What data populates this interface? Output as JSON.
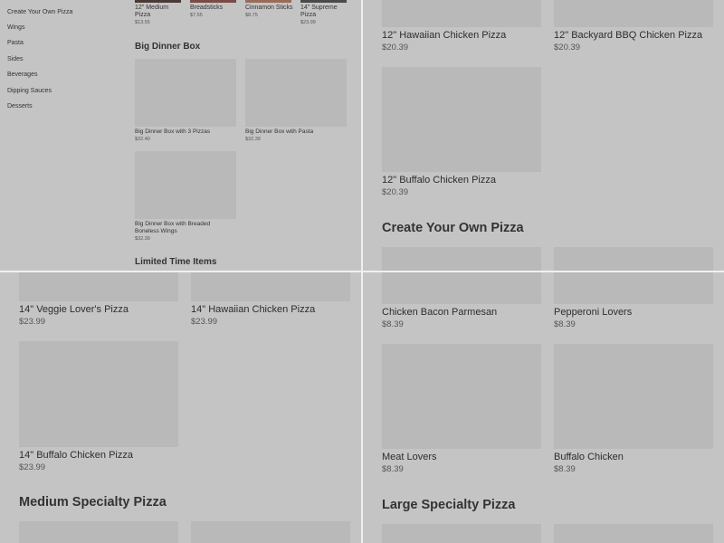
{
  "sidebar": {
    "items": [
      "Create Your Own Pizza",
      "Wings",
      "Pasta",
      "Sides",
      "Beverages",
      "Dipping Sauces",
      "Desserts"
    ]
  },
  "q1": {
    "top_items": [
      {
        "name": "12\" Medium Pizza",
        "price": "$13.55"
      },
      {
        "name": "Breadsticks",
        "price": "$7.55"
      },
      {
        "name": "Cinnamon Sticks",
        "price": "$8.75"
      },
      {
        "name": "14\" Supreme Pizza",
        "price": "$23.99"
      }
    ],
    "big_dinner_heading": "Big Dinner Box",
    "big_dinner": [
      {
        "name": "Big Dinner Box with 3 Pizzas",
        "price": "$32.40"
      },
      {
        "name": "Big Dinner Box with Pasta",
        "price": "$32.39"
      },
      {
        "name": "Big Dinner Box with Breaded Boneless Wings",
        "price": "$32.39"
      }
    ],
    "limited_heading": "Limited Time Items"
  },
  "q2": {
    "items": [
      {
        "name": "12\" Hawaiian Chicken Pizza",
        "price": "$20.39"
      },
      {
        "name": "12\" Backyard BBQ Chicken Pizza",
        "price": "$20.39"
      },
      {
        "name": "12\" Buffalo Chicken Pizza",
        "price": "$20.39"
      }
    ],
    "heading": "Create Your Own Pizza"
  },
  "q3": {
    "items": [
      {
        "name": "14\" Veggie Lover's Pizza",
        "price": "$23.99"
      },
      {
        "name": "14\" Hawaiian Chicken Pizza",
        "price": "$23.99"
      },
      {
        "name": "14\" Buffalo Chicken Pizza",
        "price": "$23.99"
      }
    ],
    "heading": "Medium Specialty Pizza"
  },
  "q4": {
    "items": [
      {
        "name": "Chicken Bacon Parmesan",
        "price": "$8.39"
      },
      {
        "name": "Pepperoni Lovers",
        "price": "$8.39"
      },
      {
        "name": "Meat Lovers",
        "price": "$8.39"
      },
      {
        "name": "Buffalo Chicken",
        "price": "$8.39"
      }
    ],
    "heading": "Large Specialty Pizza"
  }
}
